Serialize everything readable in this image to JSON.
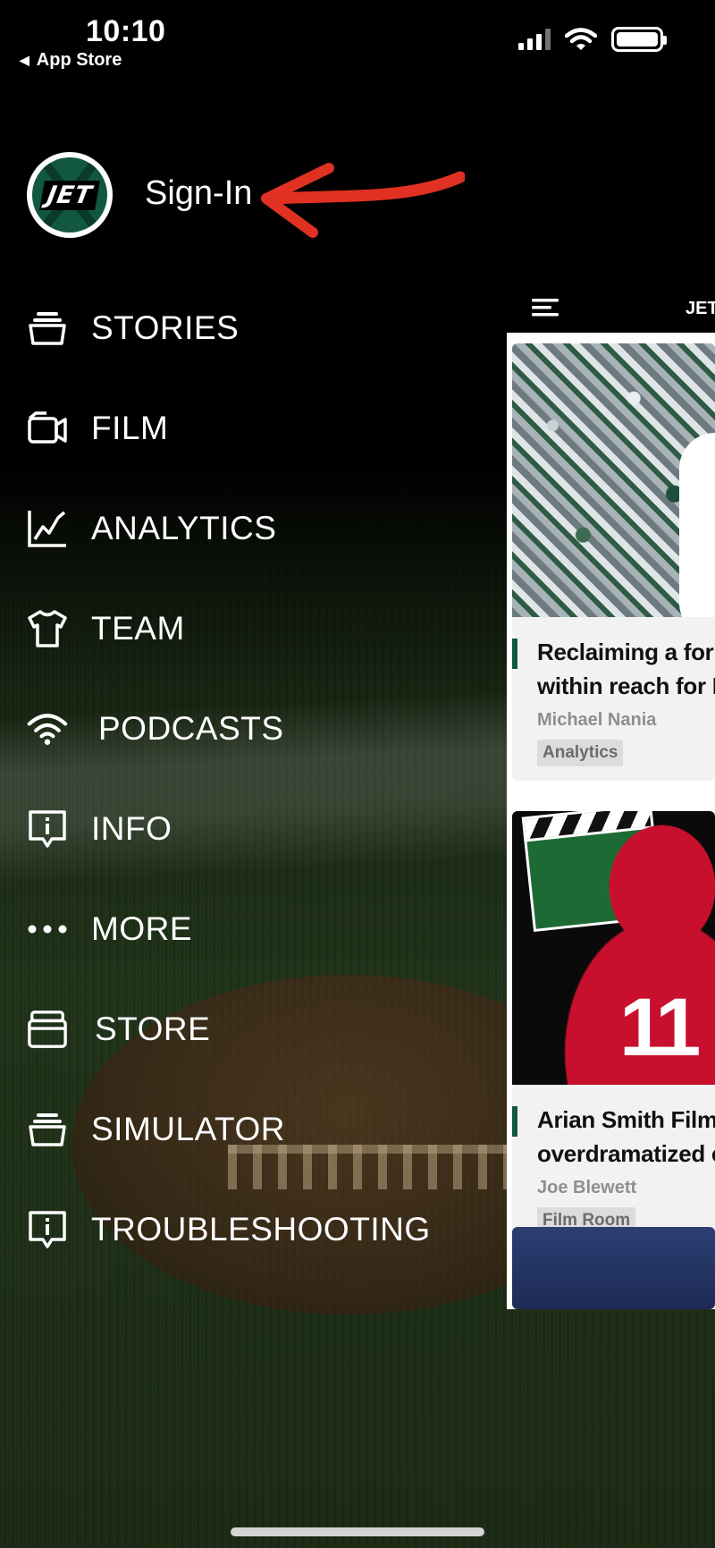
{
  "status_bar": {
    "time": "10:10",
    "back_label": "App Store"
  },
  "header": {
    "logo_text": "JET",
    "signin_label": "Sign-In",
    "accent_color": "#125740",
    "arrow_color": "#e03122"
  },
  "menu": {
    "items": [
      {
        "label": "STORIES",
        "icon": "stack-icon"
      },
      {
        "label": "FILM",
        "icon": "video-camera-icon"
      },
      {
        "label": "ANALYTICS",
        "icon": "line-chart-icon"
      },
      {
        "label": "TEAM",
        "icon": "jersey-icon"
      },
      {
        "label": "PODCASTS",
        "icon": "wifi-icon"
      },
      {
        "label": "INFO",
        "icon": "info-bubble-icon"
      },
      {
        "label": "MORE",
        "icon": "more-dots-icon"
      },
      {
        "label": "STORE",
        "icon": "store-box-icon"
      },
      {
        "label": "SIMULATOR",
        "icon": "stack-icon"
      },
      {
        "label": "TROUBLESHOOTING",
        "icon": "info-bubble-icon"
      }
    ]
  },
  "content_panel": {
    "title": "JET",
    "cards": [
      {
        "title_line1": "Reclaiming a forme",
        "title_line2": "within reach for NY",
        "author": "Michael Nania",
        "tag": "Analytics"
      },
      {
        "title_line1": "Arian Smith Film R",
        "title_line2": "overdramatized or",
        "author": "Joe Blewett",
        "tag": "Film Room",
        "jersey_number": "11"
      }
    ]
  }
}
